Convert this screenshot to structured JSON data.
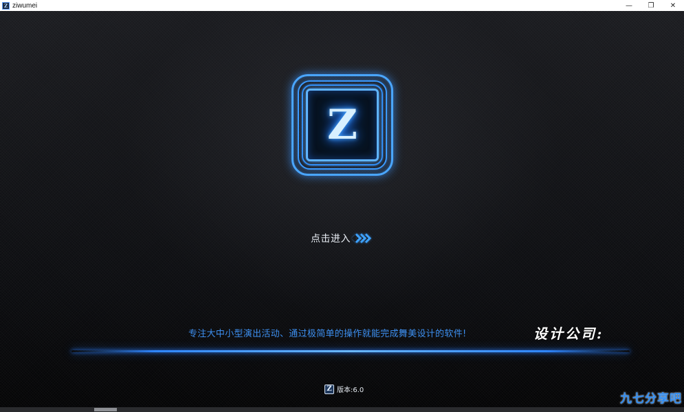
{
  "window": {
    "title": "ziwumei",
    "icon_letter": "Z",
    "controls": {
      "minimize": "—",
      "restore": "❐",
      "close": "✕"
    }
  },
  "logo": {
    "letter": "Z",
    "accent": "#3ea2ff"
  },
  "enter": {
    "label": "点击进入"
  },
  "slogan": "专注大中小型演出活动、通过极简单的操作就能完成舞美设计的软件!",
  "company": "设计公司:",
  "version": {
    "icon_letter": "Z",
    "text": "版本:6.0"
  },
  "watermark": "九七分享吧",
  "colors": {
    "background": "#0b0c0e",
    "accent_blue": "#3ea2ff",
    "slogan_blue": "#3d8ff0"
  }
}
